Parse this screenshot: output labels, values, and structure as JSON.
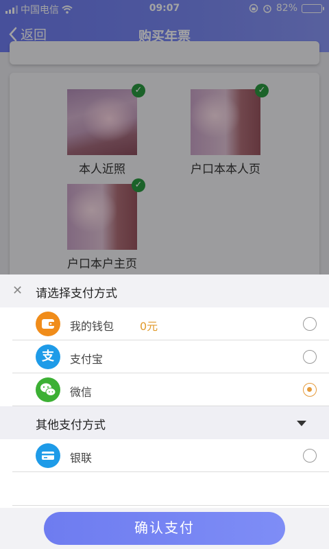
{
  "status_bar": {
    "carrier": "中国电信",
    "time": "09:07",
    "battery": "82%"
  },
  "nav": {
    "back_label": "返回",
    "title": "购买年票"
  },
  "photos": [
    {
      "caption": "本人近照"
    },
    {
      "caption": "户口本本人页"
    },
    {
      "caption": "户口本户主页"
    }
  ],
  "sheet": {
    "title": "请选择支付方式",
    "options": [
      {
        "label": "我的钱包",
        "amount": "0元",
        "icon": "wallet-icon",
        "color": "#f08c1a",
        "selected": false
      },
      {
        "label": "支付宝",
        "icon": "alipay-icon",
        "color": "#1e9be8",
        "selected": false
      },
      {
        "label": "微信",
        "icon": "wechat-icon",
        "color": "#3cb034",
        "selected": true
      }
    ],
    "other_title": "其他支付方式",
    "other_options": [
      {
        "label": "银联",
        "icon": "unionpay-card-icon",
        "color": "#1e9be8",
        "selected": false
      }
    ],
    "confirm_label": "确认支付"
  },
  "colors": {
    "accent": "#7280f3",
    "selected_radio": "#e59a3a",
    "wallet_amount": "#e09a2b"
  }
}
